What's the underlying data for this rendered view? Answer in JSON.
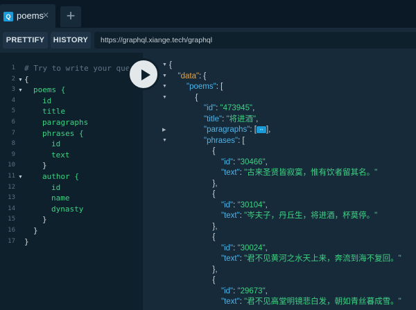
{
  "tab": {
    "icon_letter": "Q",
    "label": "poems",
    "close": "✕"
  },
  "add_tab": "+",
  "toolbar": {
    "prettify": "PRETTIFY",
    "history": "HISTORY",
    "url": "https://graphql.xiange.tech/graphql"
  },
  "query_lines": [
    {
      "n": "1",
      "text": "# Try to write your que",
      "kind": "comment",
      "indent": 0,
      "fold": false
    },
    {
      "n": "2",
      "text": "{",
      "kind": "brace",
      "indent": 0,
      "fold": true
    },
    {
      "n": "3",
      "text": "poems {",
      "kind": "field",
      "indent": 1,
      "fold": true
    },
    {
      "n": "4",
      "text": "id",
      "kind": "field",
      "indent": 2,
      "fold": false
    },
    {
      "n": "5",
      "text": "title",
      "kind": "field",
      "indent": 2,
      "fold": false
    },
    {
      "n": "6",
      "text": "paragraphs",
      "kind": "field",
      "indent": 2,
      "fold": false
    },
    {
      "n": "7",
      "text": "phrases {",
      "kind": "field",
      "indent": 2,
      "fold": false
    },
    {
      "n": "8",
      "text": "id",
      "kind": "field",
      "indent": 3,
      "fold": false
    },
    {
      "n": "9",
      "text": "text",
      "kind": "field",
      "indent": 3,
      "fold": false
    },
    {
      "n": "10",
      "text": "}",
      "kind": "brace",
      "indent": 2,
      "fold": false
    },
    {
      "n": "11",
      "text": "author {",
      "kind": "field",
      "indent": 2,
      "fold": true
    },
    {
      "n": "12",
      "text": "id",
      "kind": "field",
      "indent": 3,
      "fold": false
    },
    {
      "n": "13",
      "text": "name",
      "kind": "field",
      "indent": 3,
      "fold": false
    },
    {
      "n": "14",
      "text": "dynasty",
      "kind": "field",
      "indent": 3,
      "fold": false
    },
    {
      "n": "15",
      "text": "}",
      "kind": "brace",
      "indent": 2,
      "fold": false
    },
    {
      "n": "16",
      "text": "}",
      "kind": "brace",
      "indent": 1,
      "fold": false
    },
    {
      "n": "17",
      "text": "}",
      "kind": "brace",
      "indent": 0,
      "fold": false
    }
  ],
  "result": {
    "data_key": "\"data\"",
    "poems_key": "\"poems\"",
    "poem": {
      "id_key": "\"id\"",
      "id_val": "\"473945\"",
      "title_key": "\"title\"",
      "title_val": "\"将进酒\"",
      "paragraphs_key": "\"paragraphs\"",
      "phrases_key": "\"phrases\""
    },
    "phrases": [
      {
        "id": "\"30466\"",
        "text": "\"古来圣贤皆寂寞，惟有饮者留其名。\""
      },
      {
        "id": "\"30104\"",
        "text": "\"岑夫子，丹丘生，将进酒，杯莫停。\""
      },
      {
        "id": "\"30024\"",
        "text": "\"君不见黄河之水天上来，奔流到海不复回。\""
      },
      {
        "id": "\"29673\"",
        "text": "\"君不见高堂明镜悲白发，朝如青丝暮成雪。\""
      }
    ],
    "id_key": "\"id\"",
    "text_key": "\"text\"",
    "ellipsis": "↔"
  },
  "colors": {
    "accent": "#1a9bd7",
    "string": "#3cd281",
    "key": "#4eb4e8",
    "data_key": "#e6a23a"
  }
}
